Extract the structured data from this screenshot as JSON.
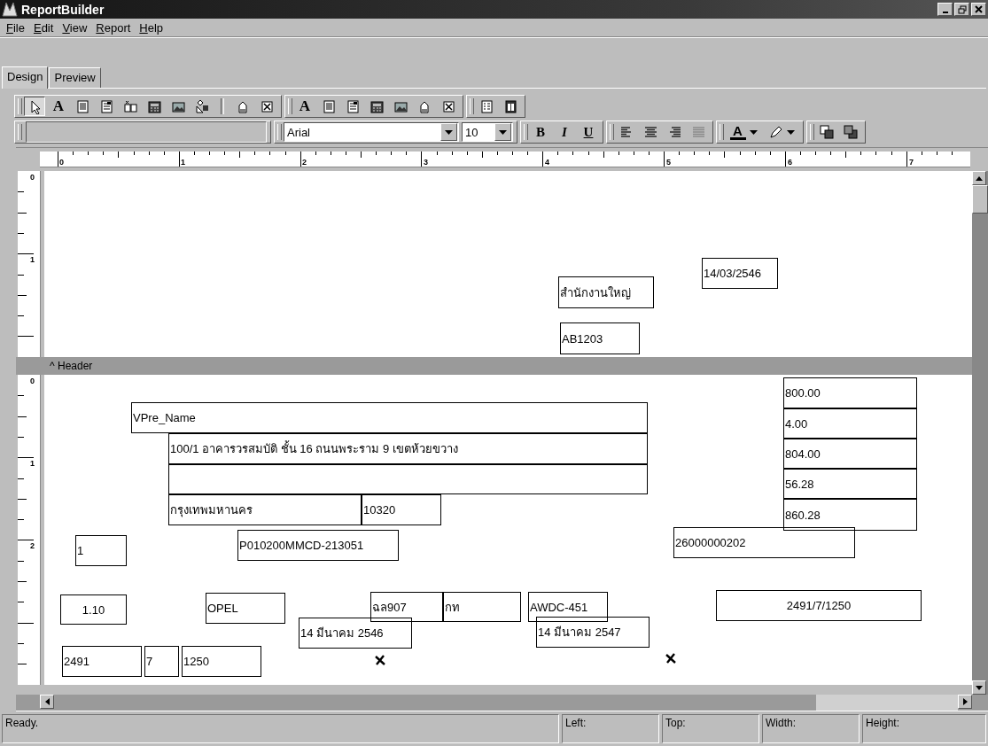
{
  "window": {
    "title": "ReportBuilder"
  },
  "menu": [
    "File",
    "Edit",
    "View",
    "Report",
    "Help"
  ],
  "tabs": [
    {
      "label": "Design",
      "selected": true
    },
    {
      "label": "Preview",
      "selected": false
    }
  ],
  "toolbar": {
    "groups": [
      [
        {
          "kind": "pointer",
          "selected": true
        },
        {
          "kind": "text",
          "glyph": "A",
          "selected": false
        },
        {
          "kind": "memo",
          "selected": false
        },
        {
          "kind": "richtext",
          "selected": false
        },
        {
          "kind": "sysvar",
          "selected": false
        },
        {
          "kind": "calc",
          "selected": false
        },
        {
          "kind": "image",
          "selected": false
        },
        {
          "kind": "shape",
          "selected": false
        },
        {
          "kind": "separator"
        },
        {
          "kind": "region",
          "selected": false
        },
        {
          "kind": "subreport",
          "selected": false
        }
      ],
      [
        {
          "kind": "text",
          "glyph": "A",
          "selected": false
        },
        {
          "kind": "memo",
          "selected": false
        },
        {
          "kind": "richtext",
          "selected": false
        },
        {
          "kind": "calc",
          "selected": false
        },
        {
          "kind": "image",
          "selected": false
        },
        {
          "kind": "region",
          "selected": false
        },
        {
          "kind": "subreport",
          "selected": false
        }
      ],
      [
        {
          "kind": "grid",
          "selected": false
        },
        {
          "kind": "columns",
          "selected": false
        }
      ]
    ]
  },
  "format_bar": {
    "font": "Arial",
    "size": "10",
    "styles": [
      "B",
      "I",
      "U"
    ],
    "color_glyph": "A"
  },
  "ruler": {
    "labels": [
      "0",
      "1",
      "2",
      "3",
      "4",
      "5",
      "6",
      "7"
    ]
  },
  "bands": [
    {
      "label": "^ Header",
      "ruler_labels": [
        "0",
        "1"
      ],
      "fields": [
        {
          "text": "14/03/2546",
          "centered": false
        },
        {
          "text": "สำนักงานใหญ่",
          "centered": false
        },
        {
          "text": "AB1203",
          "centered": false
        }
      ]
    },
    {
      "ruler_labels": [
        "0",
        "1",
        "2"
      ],
      "fields": [
        {
          "text": "VPre_Name",
          "centered": false
        },
        {
          "text": "100/1 อาคารวรสมบัติ ชั้น 16 ถนนพระราม 9 เขตห้วยขวาง",
          "centered": false
        },
        {
          "kind": "blank"
        },
        {
          "text": "กรุงเทพมหานคร",
          "centered": false
        },
        {
          "text": "10320",
          "centered": false
        },
        {
          "text": "800.00",
          "centered": false
        },
        {
          "text": "4.00",
          "centered": false
        },
        {
          "text": "804.00",
          "centered": false
        },
        {
          "text": "56.28",
          "centered": false
        },
        {
          "text": "860.28",
          "centered": false
        },
        {
          "text": "1",
          "centered": false
        },
        {
          "text": "P010200MMCD-213051",
          "centered": false
        },
        {
          "text": "26000000202",
          "centered": false
        },
        {
          "text": "1.10",
          "centered": true
        },
        {
          "text": "OPEL",
          "centered": false
        },
        {
          "text": "ฉล907",
          "centered": false
        },
        {
          "text": "กท",
          "centered": false
        },
        {
          "text": "14 มีนาคม 2546",
          "centered": false
        },
        {
          "text": "AWDC-451",
          "centered": false
        },
        {
          "text": "14 มีนาคม 2547",
          "centered": false
        },
        {
          "text": "2491/7/1250",
          "centered": true
        },
        {
          "text": "2491",
          "centered": false
        },
        {
          "text": "7",
          "centered": false
        },
        {
          "text": "1250",
          "centered": false
        }
      ]
    }
  ],
  "status_bar": [
    "Ready.",
    "Left:",
    "Top:",
    "Width:",
    "Height:"
  ]
}
